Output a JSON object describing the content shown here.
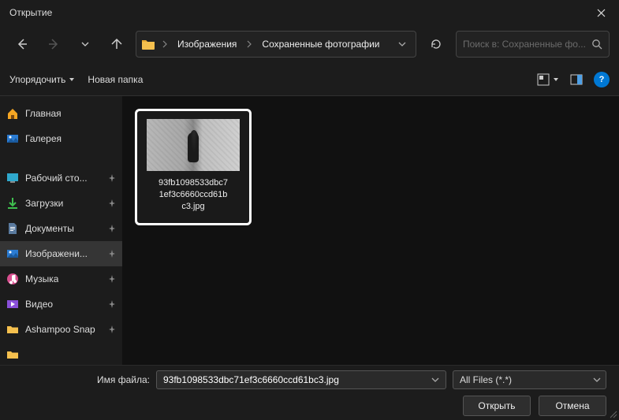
{
  "title": "Открытие",
  "breadcrumb": {
    "seg1": "Изображения",
    "seg2": "Сохраненные фотографии"
  },
  "search": {
    "placeholder": "Поиск в: Сохраненные фо..."
  },
  "toolbar": {
    "organize": "Упорядочить",
    "new_folder": "Новая папка"
  },
  "sidebar": {
    "items": [
      {
        "label": "Главная",
        "pin": false
      },
      {
        "label": "Галерея",
        "pin": false
      },
      {
        "label": "Рабочий сто...",
        "pin": true
      },
      {
        "label": "Загрузки",
        "pin": true
      },
      {
        "label": "Документы",
        "pin": true
      },
      {
        "label": "Изображени...",
        "pin": true,
        "selected": true
      },
      {
        "label": "Музыка",
        "pin": true
      },
      {
        "label": "Видео",
        "pin": true
      },
      {
        "label": "Ashampoo Snap",
        "pin": true
      }
    ]
  },
  "file": {
    "name_l1": "93fb1098533dbc7",
    "name_l2": "1ef3c6660ccd61b",
    "name_l3": "c3.jpg"
  },
  "bottom": {
    "filename_label": "Имя файла:",
    "filename_value": "93fb1098533dbc71ef3c6660ccd61bc3.jpg",
    "filter_label": "All Files (*.*)",
    "open": "Открыть",
    "cancel": "Отмена"
  }
}
